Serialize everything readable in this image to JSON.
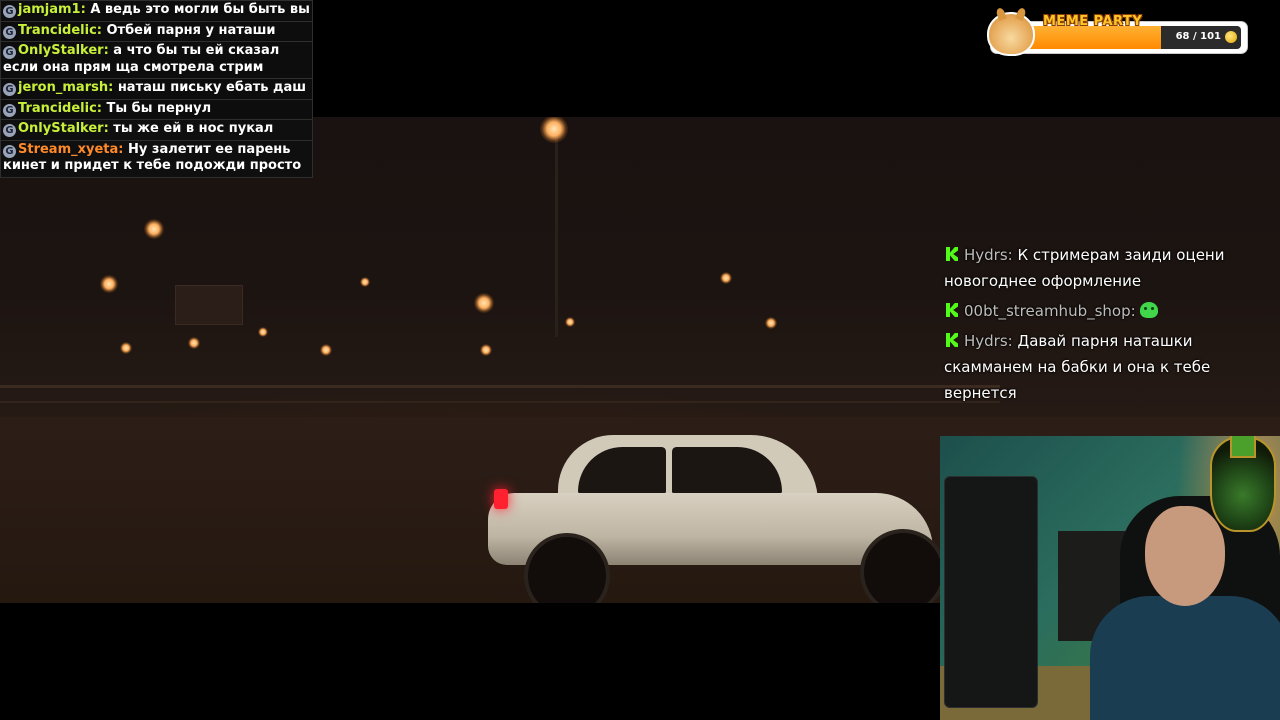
{
  "chat_left": {
    "badge_letter": "G",
    "messages": [
      {
        "user": "jamjam1:",
        "text": " А ведь это могли бы быть вы",
        "nick_color": "#c8f03a"
      },
      {
        "user": "Trancidelic:",
        "text": " Отбей парня у наташи",
        "nick_color": "#c8f03a"
      },
      {
        "user": "OnlyStalker:",
        "text": " а что бы ты ей сказал если она прям ща смотрела стрим",
        "nick_color": "#c8f03a"
      },
      {
        "user": "jeron_marsh:",
        "text": " наташ письку ебать даш",
        "nick_color": "#c8f03a"
      },
      {
        "user": "Trancidelic:",
        "text": " Ты бы пернул",
        "nick_color": "#c8f03a"
      },
      {
        "user": "OnlyStalker:",
        "text": " ты же ей в нос пукал",
        "nick_color": "#c8f03a"
      },
      {
        "user": "Stream_xyeta:",
        "text": " Ну залетит ее парень кинет и придет к тебе подожди просто",
        "nick_color": "#ff8a2a"
      }
    ]
  },
  "meme_party": {
    "title": "MEME PARTY",
    "current": 68,
    "max": 101,
    "count_label": "68 / 101",
    "progress": 0.673
  },
  "chat_right": {
    "messages": [
      {
        "user": "Hydrs:",
        "text": " К стримерам заиди оцени новогоднее оформление"
      },
      {
        "user": "00bt_streamhub_shop:",
        "text": " ",
        "emote": "green-blob-emote"
      },
      {
        "user": "Hydrs:",
        "text": " Давай парня наташки скамманем на бабки и она к тебе вернется"
      }
    ]
  }
}
